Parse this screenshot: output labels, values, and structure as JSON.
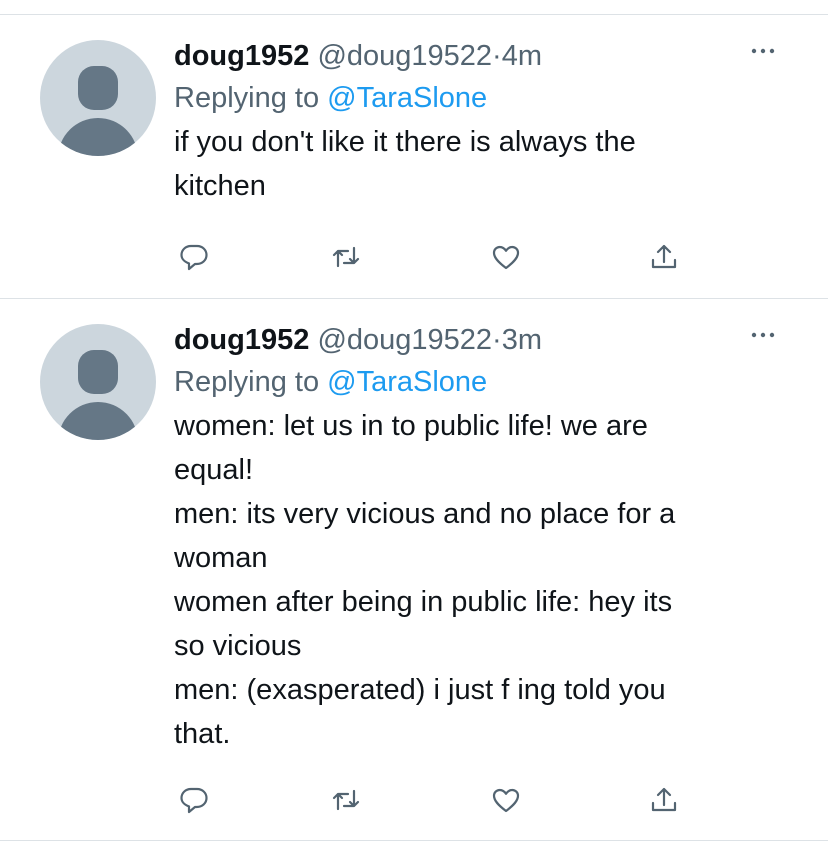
{
  "tweets": [
    {
      "display_name": "doug1952",
      "handle": "@doug19522",
      "separator": "·",
      "time": "4m",
      "reply_prefix": "Replying to",
      "reply_mention": "@TaraSlone",
      "text": "if you don't like it there is always the\nkitchen"
    },
    {
      "display_name": "doug1952",
      "handle": "@doug19522",
      "separator": "·",
      "time": "3m",
      "reply_prefix": "Replying to",
      "reply_mention": "@TaraSlone",
      "text": "women: let us in to public life! we are\nequal!\nmen: its very vicious and no place for a\nwoman\nwomen after being in public life: hey its\nso vicious\nmen: (exasperated) i just f ing told you\nthat."
    }
  ],
  "icons": {
    "more": "more-horizontal-icon",
    "reply": "reply-icon",
    "retweet": "retweet-icon",
    "like": "heart-icon",
    "share": "share-icon"
  },
  "colors": {
    "mention": "#1d9bf0",
    "secondary_text": "#536471",
    "avatar_bg": "#ccd6dd",
    "avatar_fg": "#657786"
  }
}
